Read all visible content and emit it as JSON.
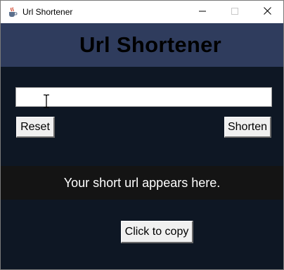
{
  "window": {
    "title": "Url Shortener",
    "app_icon": "java-cup-icon",
    "controls": [
      "minimize-icon",
      "maximize-icon",
      "close-icon"
    ]
  },
  "header": {
    "title": "Url Shortener"
  },
  "form": {
    "url_input_value": "",
    "reset_label": "Reset",
    "shorten_label": "Shorten"
  },
  "result": {
    "text": "Your short url appears here."
  },
  "copy": {
    "label": "Click to copy"
  },
  "colors": {
    "background": "#0e1724",
    "header": "#2f3c5d",
    "result_band": "#141414",
    "button": "#f0f0f0"
  }
}
